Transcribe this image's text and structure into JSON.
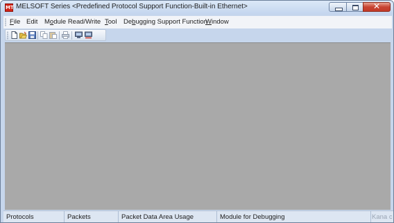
{
  "window": {
    "title": "MELSOFT Series <Predefined Protocol Support Function-Built-in Ethernet>",
    "app_icon_text": "MT"
  },
  "caption_buttons": {
    "close_glyph": "✕"
  },
  "menu": {
    "items": [
      {
        "label": "File",
        "accel": "F",
        "rest": "ile"
      },
      {
        "label": "Edit",
        "accel": "",
        "rest": "Edit"
      },
      {
        "label": "Module Read/Write",
        "pre": "M",
        "accel": "o",
        "rest": "dule Read/Write"
      },
      {
        "label": "Tool",
        "accel": "T",
        "rest": "ool"
      },
      {
        "label": "Debugging Support Function",
        "pre": "De",
        "accel": "b",
        "rest": "ugging Support Function"
      },
      {
        "label": "Window",
        "accel": "W",
        "rest": "indow"
      }
    ]
  },
  "toolbar": {
    "icons": [
      "new-icon",
      "open-icon",
      "save-icon",
      "copy-icon",
      "paste-icon",
      "print-icon",
      "connect-icon",
      "disconnect-icon"
    ]
  },
  "statusbar": {
    "cells": [
      "Protocols",
      "Packets",
      "Packet Data Area Usage",
      "Module for Debugging",
      "Kana c SC"
    ]
  }
}
